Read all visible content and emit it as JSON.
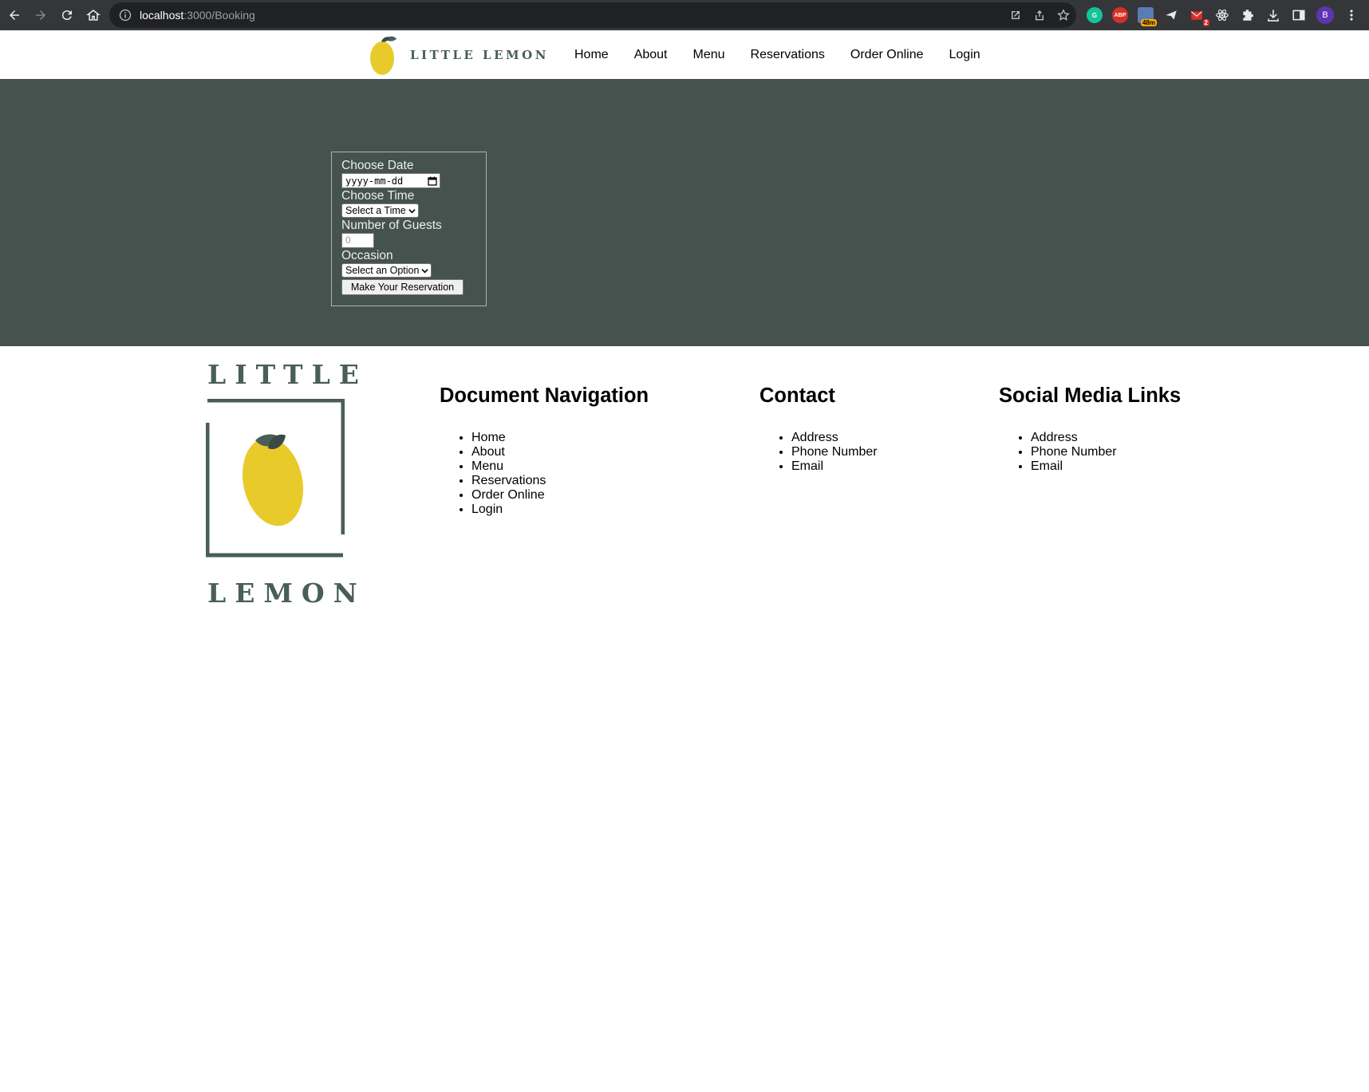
{
  "browser": {
    "url_host": "localhost",
    "url_path": ":3000/Booking",
    "ext_badge_timer": "48m",
    "ext_badge_mail": "2",
    "profile_initial": "B",
    "abp_label": "ABP"
  },
  "header": {
    "brand": "LITTLE LEMON",
    "nav": [
      "Home",
      "About",
      "Menu",
      "Reservations",
      "Order Online",
      "Login"
    ]
  },
  "booking": {
    "date_label": "Choose Date",
    "date_placeholder": "yyyy-mm-dd",
    "time_label": "Choose Time",
    "time_selected": "Select a Time",
    "guests_label": "Number of Guests",
    "guests_placeholder": "0",
    "occasion_label": "Occasion",
    "occasion_selected": "Select an Option",
    "submit_label": "Make Your Reservation"
  },
  "footer": {
    "logo_top": "LITTLE",
    "logo_bottom": "LEMON",
    "nav_title": "Document Navigation",
    "nav_items": [
      "Home",
      "About",
      "Menu",
      "Reservations",
      "Order Online",
      "Login"
    ],
    "contact_title": "Contact",
    "contact_items": [
      "Address",
      "Phone Number",
      "Email"
    ],
    "social_title": "Social Media Links",
    "social_items": [
      "Address",
      "Phone Number",
      "Email"
    ]
  },
  "colors": {
    "brand_green": "#495e57",
    "hero_bg": "#45524e",
    "lemon_yellow": "#e8cb2b"
  }
}
